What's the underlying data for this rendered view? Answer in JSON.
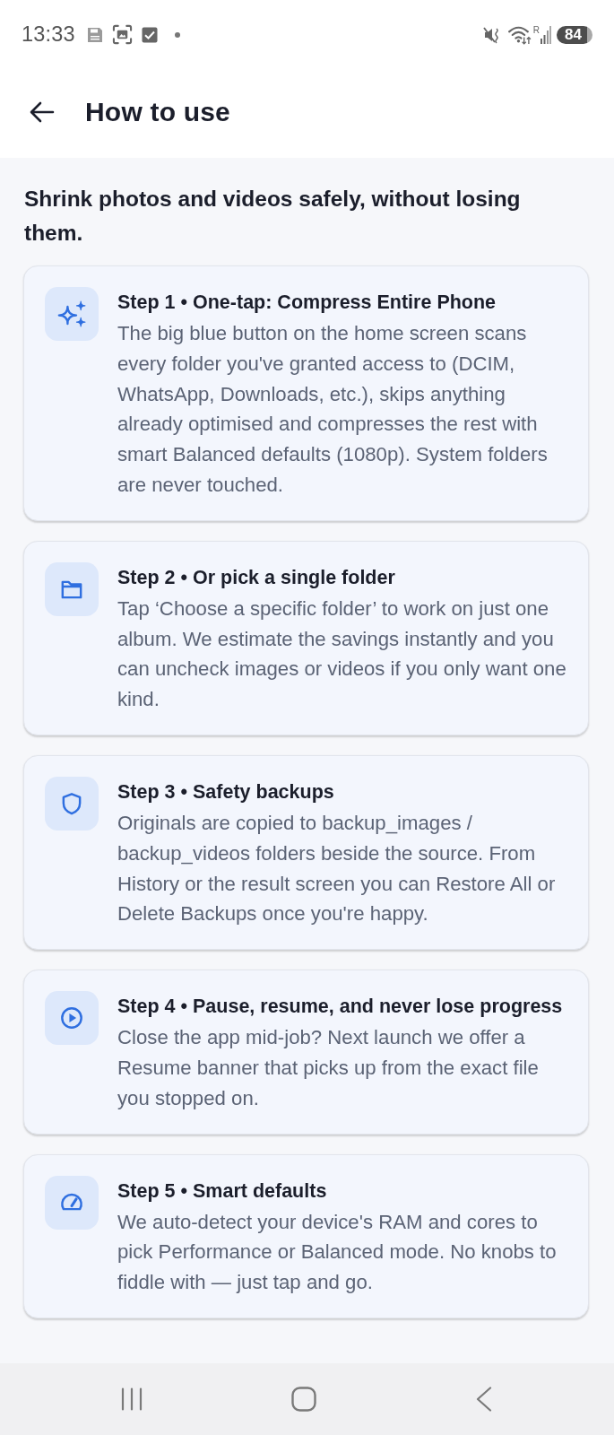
{
  "status_bar": {
    "time": "13:33",
    "roaming": "R",
    "battery": "84"
  },
  "app_bar": {
    "title": "How to use"
  },
  "intro": "Shrink photos and videos safely, without losing them.",
  "steps": [
    {
      "kind": "sparkles",
      "title": "Step 1 • One-tap: Compress Entire Phone",
      "body": "The big blue button on the home screen scans every folder you've granted access to (DCIM, WhatsApp, Downloads, etc.), skips anything already optimised and compresses the rest with smart Balanced defaults (1080p). System folders are never touched."
    },
    {
      "kind": "folder",
      "title": "Step 2 • Or pick a single folder",
      "body": "Tap ‘Choose a specific folder’ to work on just one album. We estimate the savings instantly and you can uncheck images or videos if you only want one kind."
    },
    {
      "kind": "shield",
      "title": "Step 3 • Safety backups",
      "body": "Originals are copied to backup_images / backup_videos folders beside the source. From History or the result screen you can Restore All or Delete Backups once you're happy."
    },
    {
      "kind": "play",
      "title": "Step 4 • Pause, resume, and never lose progress",
      "body": "Close the app mid-job? Next launch we offer a Resume banner that picks up from the exact file you stopped on."
    },
    {
      "kind": "gauge",
      "title": "Step 5 • Smart defaults",
      "body": "We auto-detect your device's RAM and cores to pick Performance or Balanced mode. No knobs to fiddle with — just tap and go."
    }
  ]
}
